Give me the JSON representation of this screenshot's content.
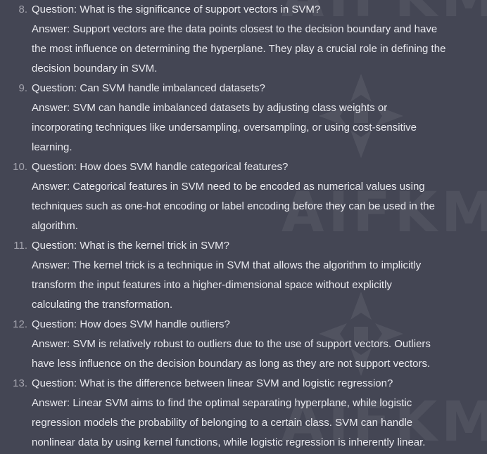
{
  "watermark": {
    "text": "AIFKM"
  },
  "items": [
    {
      "number": "8.",
      "question": "Question: What is the significance of support vectors in SVM?",
      "answer_lines": [
        "Answer: Support vectors are the data points closest to the decision boundary and have",
        "the most influence on determining the hyperplane. They play a crucial role in defining the",
        "decision boundary in SVM."
      ]
    },
    {
      "number": "9.",
      "question": "Question: Can SVM handle imbalanced datasets?",
      "answer_lines": [
        "Answer: SVM can handle imbalanced datasets by adjusting class weights or",
        "incorporating techniques like undersampling, oversampling, or using cost-sensitive",
        "learning."
      ]
    },
    {
      "number": "10.",
      "question": "Question: How does SVM handle categorical features?",
      "answer_lines": [
        "Answer: Categorical features in SVM need to be encoded as numerical values using",
        "techniques such as one-hot encoding or label encoding before they can be used in the",
        "algorithm."
      ]
    },
    {
      "number": "11.",
      "question": "Question: What is the kernel trick in SVM?",
      "answer_lines": [
        "Answer: The kernel trick is a technique in SVM that allows the algorithm to implicitly",
        "transform the input features into a higher-dimensional space without explicitly",
        "calculating the transformation."
      ]
    },
    {
      "number": "12.",
      "question": "Question: How does SVM handle outliers?",
      "answer_lines": [
        "Answer: SVM is relatively robust to outliers due to the use of support vectors. Outliers",
        "have less influence on the decision boundary as long as they are not support vectors."
      ]
    },
    {
      "number": "13.",
      "question": "Question: What is the difference between linear SVM and logistic regression?",
      "answer_lines": [
        "Answer: Linear SVM aims to find the optimal separating hyperplane, while logistic",
        "regression models the probability of belonging to a certain class. SVM can handle",
        "nonlinear data by using kernel functions, while logistic regression is inherently linear."
      ]
    }
  ]
}
